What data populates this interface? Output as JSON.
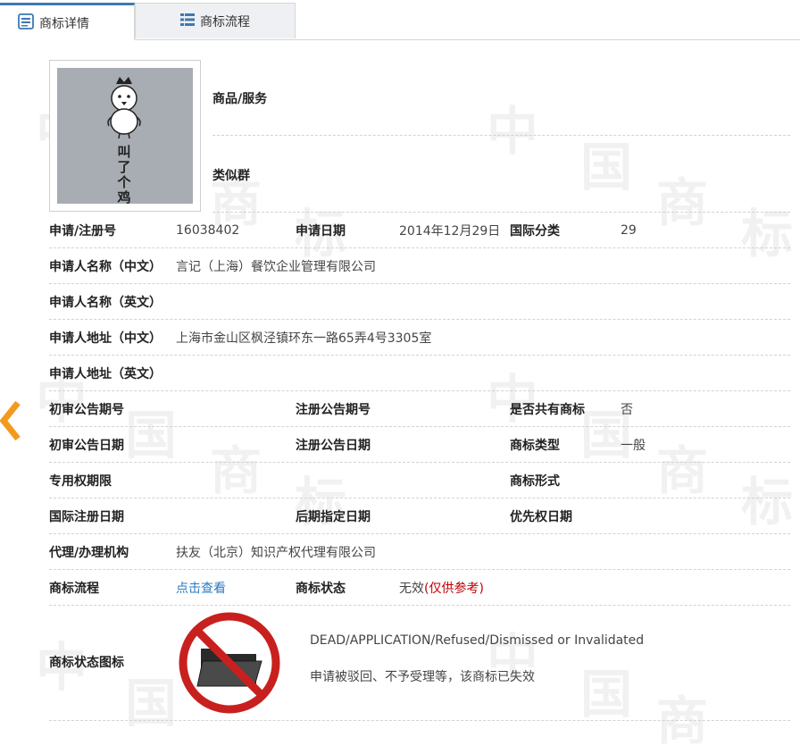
{
  "tabs": {
    "detail_label": "商标详情",
    "flow_label": "商标流程"
  },
  "trademark_image_text": [
    "叫",
    "了",
    "个",
    "鸡"
  ],
  "goods_label": "商品/服务",
  "group_label": "类似群",
  "fields": {
    "reg_no_label": "申请/注册号",
    "reg_no_value": "16038402",
    "app_date_label": "申请日期",
    "app_date_value": "2014年12月29日",
    "intl_class_label": "国际分类",
    "intl_class_value": "29",
    "applicant_cn_label": "申请人名称（中文）",
    "applicant_cn_value": "言记（上海）餐饮企业管理有限公司",
    "applicant_en_label": "申请人名称（英文）",
    "address_cn_label": "申请人地址（中文）",
    "address_cn_value": "上海市金山区枫泾镇环东一路65弄4号3305室",
    "address_en_label": "申请人地址（英文）",
    "prelim_pub_no_label": "初审公告期号",
    "reg_pub_no_label": "注册公告期号",
    "shared_label": "是否共有商标",
    "shared_value": "否",
    "prelim_pub_date_label": "初审公告日期",
    "reg_pub_date_label": "注册公告日期",
    "tm_type_label": "商标类型",
    "tm_type_value": "一般",
    "exclusive_period_label": "专用权期限",
    "tm_form_label": "商标形式",
    "intl_reg_date_label": "国际注册日期",
    "later_designation_label": "后期指定日期",
    "priority_date_label": "优先权日期",
    "agent_label": "代理/办理机构",
    "agent_value": "扶友（北京）知识产权代理有限公司",
    "flow_label": "商标流程",
    "flow_link": "点击查看",
    "status_label": "商标状态",
    "status_value": "无效",
    "status_note": "(仅供参考)"
  },
  "status_icon": {
    "label": "商标状态图标",
    "en_text": "DEAD/APPLICATION/Refused/Dismissed or Invalidated",
    "cn_text": "申请被驳回、不予受理等，该商标已失效",
    "color": "#c8201e"
  },
  "accent_color": "#3d78b3",
  "arrow_color": "#f39a1e",
  "watermark_chars": [
    "中",
    "国",
    "商",
    "标"
  ]
}
